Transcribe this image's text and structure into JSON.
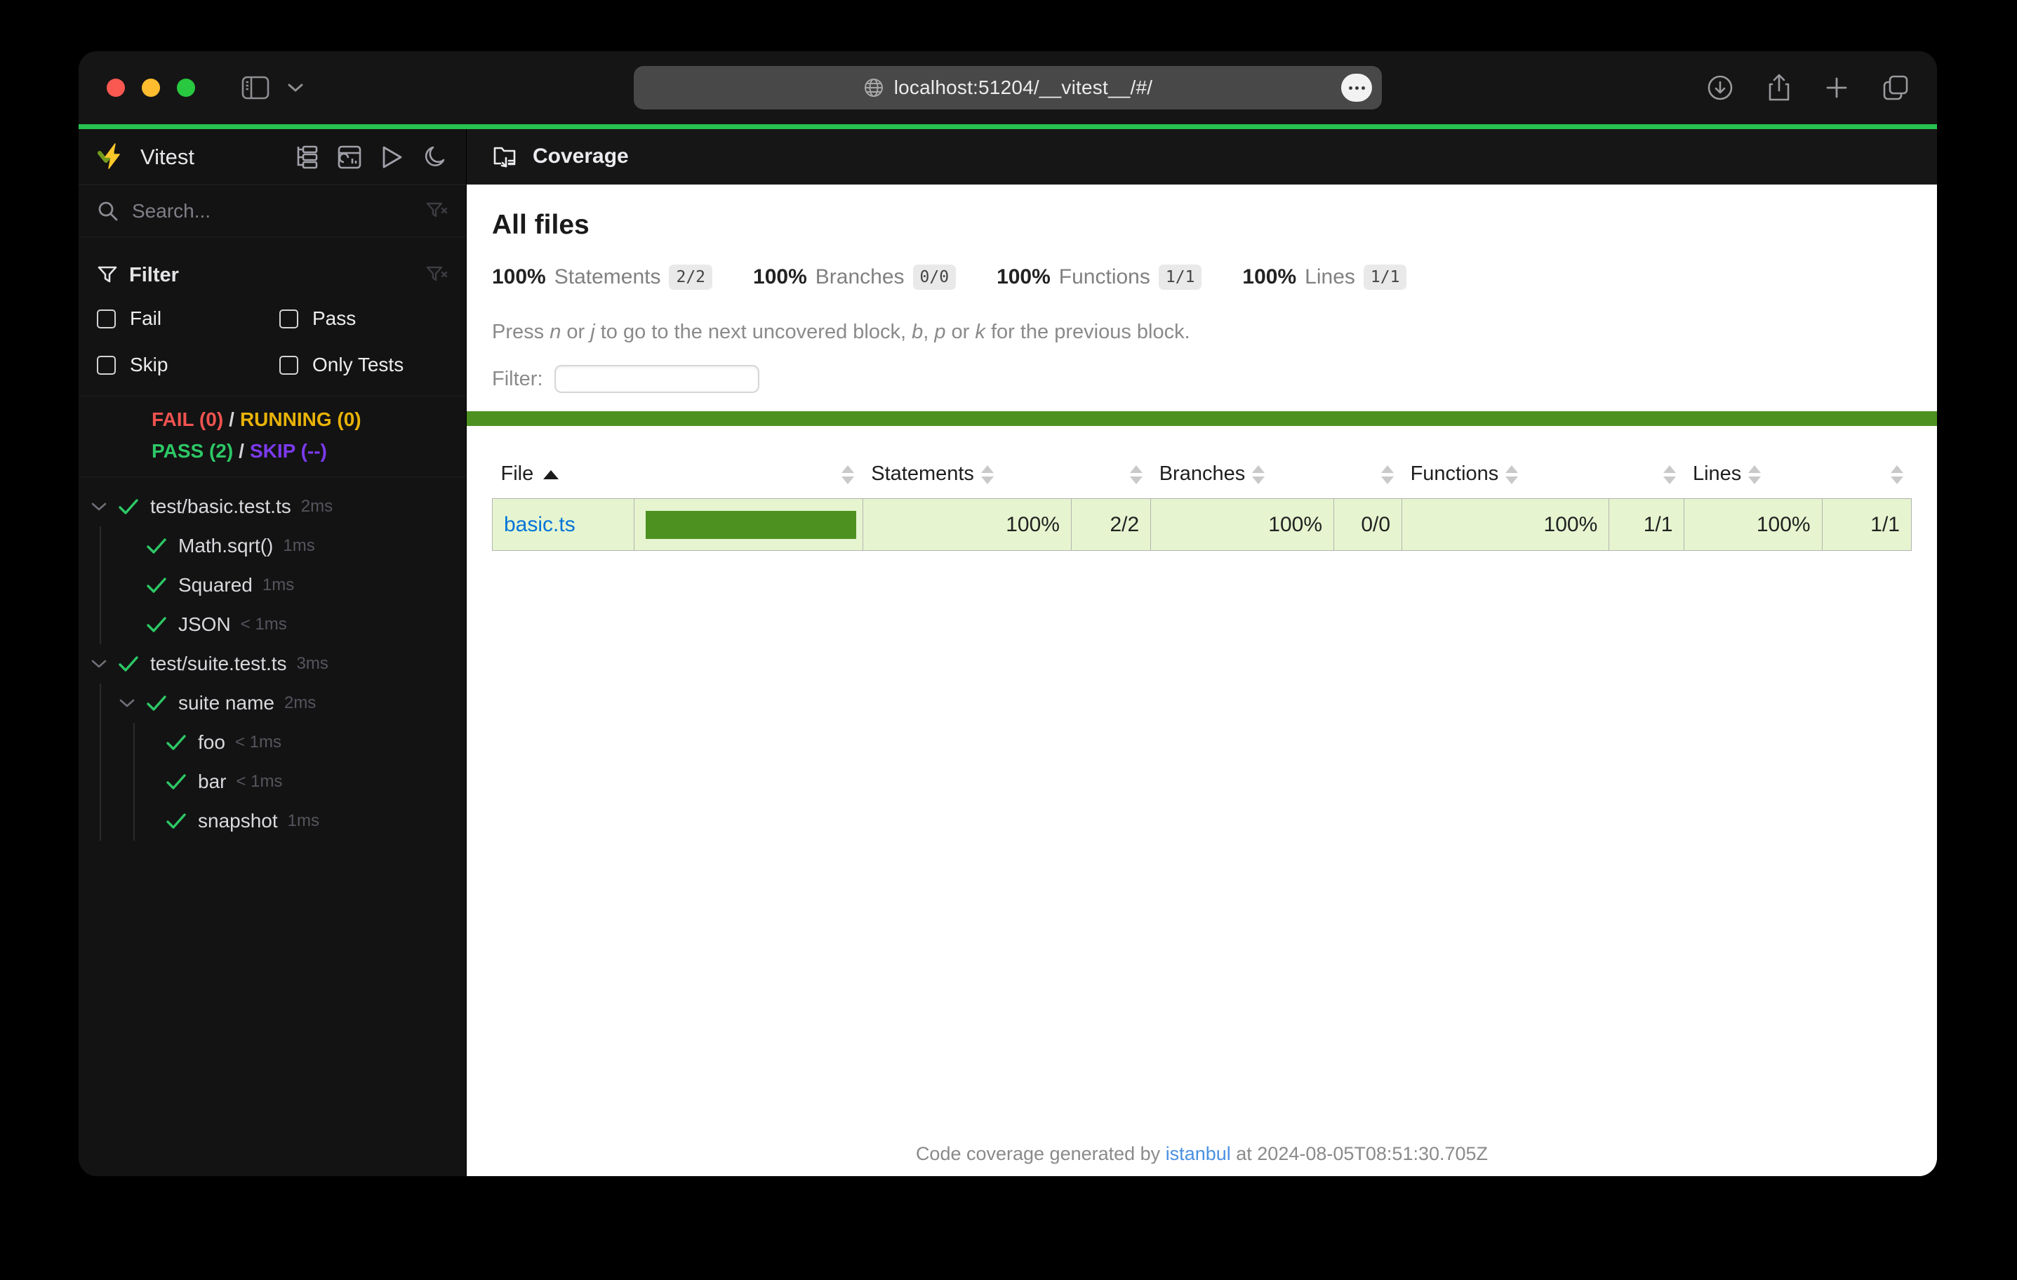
{
  "browser": {
    "url": "localhost:51204/__vitest__/#/"
  },
  "colors": {
    "accent_green": "#27c150",
    "coverage_green": "#4d9221",
    "coverage_row_bg": "#e6f5d0",
    "fail_red": "#ef5350",
    "running_yellow": "#e9b308",
    "pass_green": "#2dc866",
    "skip_purple": "#7c3aed",
    "link_blue": "#0074d9"
  },
  "icons": {
    "window": [
      "close-light",
      "minimize-light",
      "zoom-light"
    ],
    "toolbar": [
      "sidebar-toggle-icon",
      "chevron-down-icon",
      "globe-icon",
      "more-icon",
      "download-icon",
      "share-icon",
      "new-tab-icon",
      "tabs-icon"
    ],
    "sidebar": [
      "vitest-logo",
      "tree-view-icon",
      "dashboard-icon",
      "run-all-icon",
      "dark-mode-icon",
      "search-icon",
      "filter-icon",
      "clear-filter-icon"
    ],
    "main": [
      "coverage-report-icon",
      "sort-asc-icon",
      "sort-both-icon",
      "check-icon",
      "chevron-expanded-icon"
    ]
  },
  "sidebar": {
    "brand": "Vitest",
    "search_placeholder": "Search...",
    "filter": {
      "title": "Filter",
      "options": [
        {
          "label": "Fail",
          "checked": false
        },
        {
          "label": "Pass",
          "checked": false
        },
        {
          "label": "Skip",
          "checked": false
        },
        {
          "label": "Only Tests",
          "checked": false
        }
      ]
    },
    "status": {
      "fail": "FAIL (0)",
      "running": "RUNNING (0)",
      "pass": "PASS (2)",
      "skip": "SKIP (--)",
      "separator": "/"
    },
    "tree": [
      {
        "label": "test/basic.test.ts",
        "duration": "2ms",
        "level": 0,
        "expandable": true,
        "state": "pass"
      },
      {
        "label": "Math.sqrt()",
        "duration": "1ms",
        "level": 1,
        "expandable": false,
        "state": "pass"
      },
      {
        "label": "Squared",
        "duration": "1ms",
        "level": 1,
        "expandable": false,
        "state": "pass"
      },
      {
        "label": "JSON",
        "duration": "< 1ms",
        "level": 1,
        "expandable": false,
        "state": "pass"
      },
      {
        "label": "test/suite.test.ts",
        "duration": "3ms",
        "level": 0,
        "expandable": true,
        "state": "pass"
      },
      {
        "label": "suite name",
        "duration": "2ms",
        "level": 1,
        "expandable": true,
        "state": "pass"
      },
      {
        "label": "foo",
        "duration": "< 1ms",
        "level": 2,
        "expandable": false,
        "state": "pass"
      },
      {
        "label": "bar",
        "duration": "< 1ms",
        "level": 2,
        "expandable": false,
        "state": "pass"
      },
      {
        "label": "snapshot",
        "duration": "1ms",
        "level": 2,
        "expandable": false,
        "state": "pass"
      }
    ]
  },
  "main": {
    "panel_title": "Coverage",
    "report": {
      "title": "All files",
      "metrics": [
        {
          "pct": "100%",
          "label": "Statements",
          "frac": "2/2"
        },
        {
          "pct": "100%",
          "label": "Branches",
          "frac": "0/0"
        },
        {
          "pct": "100%",
          "label": "Functions",
          "frac": "1/1"
        },
        {
          "pct": "100%",
          "label": "Lines",
          "frac": "1/1"
        }
      ],
      "hint_parts": [
        "Press ",
        "n",
        " or ",
        "j",
        " to go to the next uncovered block, ",
        "b",
        ", ",
        "p",
        " or ",
        "k",
        " for the previous block."
      ],
      "filter_label": "Filter:",
      "filter_value": "",
      "table": {
        "columns": [
          "File",
          "Statements",
          "Branches",
          "Functions",
          "Lines"
        ],
        "sort": {
          "column": "File",
          "direction": "asc"
        },
        "rows": [
          {
            "file": "basic.ts",
            "bar_pct": 100,
            "statements_pct": "100%",
            "statements_frac": "2/2",
            "branches_pct": "100%",
            "branches_frac": "0/0",
            "functions_pct": "100%",
            "functions_frac": "1/1",
            "lines_pct": "100%",
            "lines_frac": "1/1"
          }
        ]
      },
      "footer": {
        "prefix": "Code coverage generated by ",
        "link": "istanbul",
        "suffix": " at 2024-08-05T08:51:30.705Z"
      }
    }
  }
}
